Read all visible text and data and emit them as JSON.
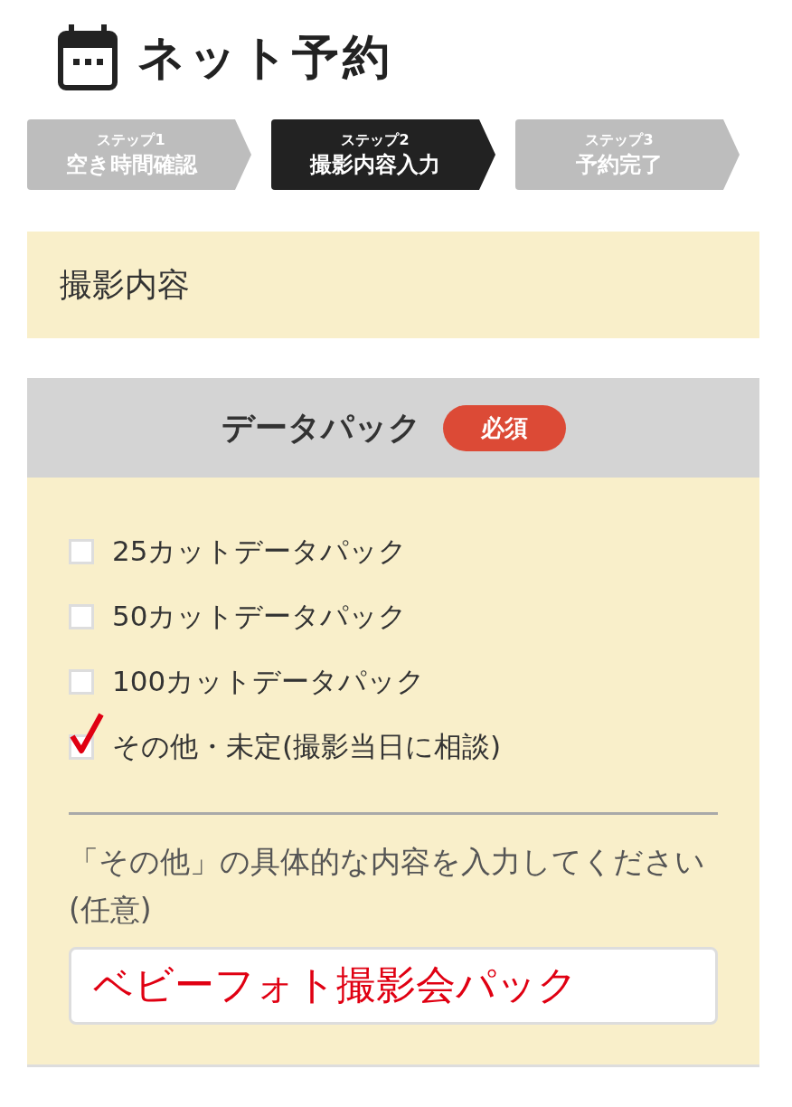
{
  "title": "ネット予約",
  "steps": [
    {
      "number": "ステップ1",
      "label": "空き時間確認",
      "selected": false
    },
    {
      "number": "ステップ2",
      "label": "撮影内容入力",
      "selected": true
    },
    {
      "number": "ステップ3",
      "label": "予約完了",
      "selected": false
    }
  ],
  "section": {
    "title": "撮影内容"
  },
  "data_pack": {
    "title": "データパック",
    "badge": "必須",
    "options": [
      {
        "label": "25カットデータパック",
        "checked": false
      },
      {
        "label": "50カットデータパック",
        "checked": false
      },
      {
        "label": "100カットデータパック",
        "checked": false
      },
      {
        "label": "その他・未定(撮影当日に相談)",
        "checked": true
      }
    ],
    "other_prompt": "「その他」の具体的な内容を入力してください(任意)",
    "other_value": "ベビーフォト撮影会パック"
  }
}
